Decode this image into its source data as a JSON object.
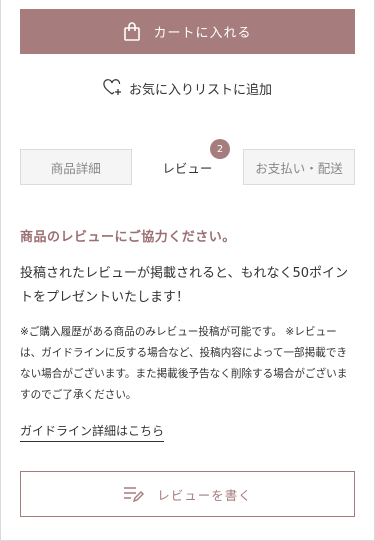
{
  "colors": {
    "accent": "#a67c7d",
    "heading": "#9a6f71",
    "tab_bg": "#f5f5f5"
  },
  "cart_button": {
    "label": "カートに入れる",
    "icon": "shopping-bag-icon"
  },
  "favorite": {
    "label": "お気に入りリストに追加",
    "icon": "heart-plus-icon"
  },
  "tabs": [
    {
      "label": "商品詳細",
      "active": false
    },
    {
      "label": "レビュー",
      "active": true,
      "badge": "2"
    },
    {
      "label": "お支払い・配送",
      "active": false
    }
  ],
  "review": {
    "heading": "商品のレビューにご協力ください。",
    "lead": "投稿されたレビューが掲載されると、もれなく50ポイントをプレゼントいたします！",
    "note": "※ご購入履歴がある商品のみレビュー投稿が可能です。 ※レビューは、ガイドラインに反する場合など、投稿内容によって一部掲載できない場合がございます。また掲載後予告なく削除する場合がございますのでご了承ください。",
    "guideline_link": "ガイドライン詳細はこちら",
    "write_button": "レビューを書く"
  }
}
